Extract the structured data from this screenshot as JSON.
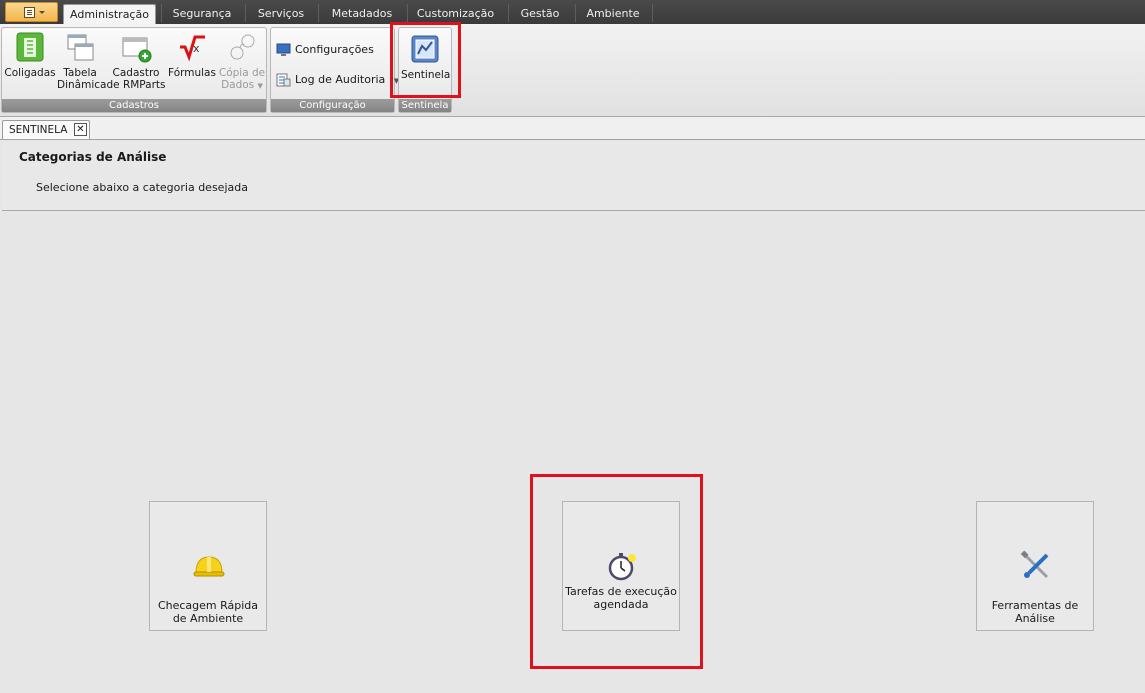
{
  "menu": {
    "tabs": [
      "Administração",
      "Segurança",
      "Serviços",
      "Metadados",
      "Customização",
      "Gestão",
      "Ambiente"
    ],
    "active_tab": "Administração"
  },
  "ribbon": {
    "cadastros": {
      "label": "Cadastros",
      "buttons": [
        {
          "label": "Coligadas",
          "icon": "building-icon"
        },
        {
          "label": "Tabela Dinâmica",
          "icon": "table-windows-icon"
        },
        {
          "label": "Cadastro de RMParts",
          "icon": "window-add-icon"
        },
        {
          "label": "Fórmulas",
          "icon": "formula-icon"
        },
        {
          "label": "Cópia de Dados",
          "icon": "copy-data-icon",
          "disabled": true
        }
      ]
    },
    "configuracao": {
      "label": "Configuração",
      "buttons": [
        {
          "label": "Configurações",
          "icon": "monitor-icon"
        },
        {
          "label": "Log de Auditoria",
          "icon": "audit-log-icon"
        }
      ]
    },
    "sentinela": {
      "label": "Sentinela",
      "buttons": [
        {
          "label": "Sentinela",
          "icon": "sentinela-icon"
        }
      ]
    }
  },
  "document_tab": {
    "label": "SENTINELA",
    "close": "✕"
  },
  "page": {
    "title": "Categorias de Análise",
    "subtitle": "Selecione abaixo a categoria desejada"
  },
  "categories": [
    {
      "label": "Checagem Rápida de Ambiente",
      "icon": "hard-hat-icon"
    },
    {
      "label": "Tarefas de execução agendada",
      "icon": "stopwatch-icon"
    },
    {
      "label": "Ferramentas de Análise",
      "icon": "tools-icon"
    }
  ],
  "colors": {
    "highlight": "#e0101c",
    "tabbar": "#3f3f3f",
    "app_button": "#f3b54b"
  }
}
